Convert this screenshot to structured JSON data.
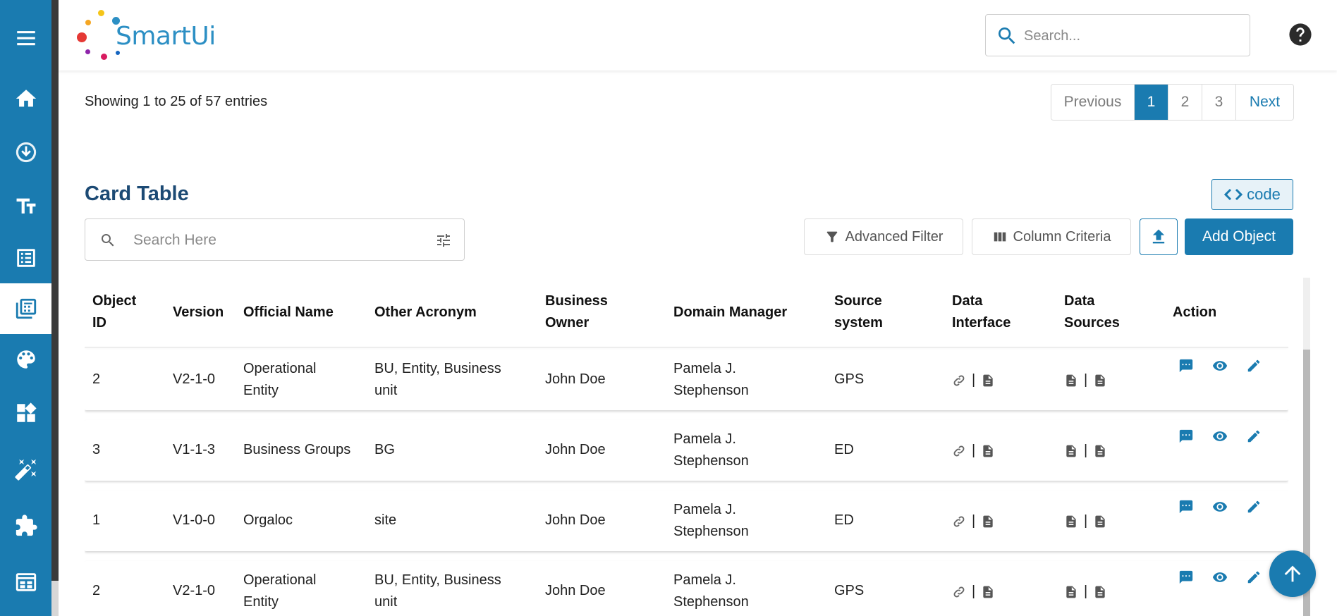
{
  "app": {
    "logo_text": "SmartUi"
  },
  "sidebar": {
    "items": [
      {
        "icon": "menu-icon"
      },
      {
        "icon": "home-icon"
      },
      {
        "icon": "download-circle-icon"
      },
      {
        "icon": "text-fields-icon"
      },
      {
        "icon": "list-alt-icon"
      },
      {
        "icon": "table-icon",
        "active": true
      },
      {
        "icon": "palette-icon"
      },
      {
        "icon": "widgets-icon"
      },
      {
        "icon": "magic-wand-icon"
      },
      {
        "icon": "extension-icon"
      },
      {
        "icon": "calendar-view-icon"
      }
    ]
  },
  "header": {
    "search_placeholder": "Search..."
  },
  "listing": {
    "showing_text": "Showing 1 to 25 of 57 entries",
    "pagination": {
      "previous": "Previous",
      "pages": [
        "1",
        "2",
        "3"
      ],
      "active_page": "1",
      "next": "Next"
    }
  },
  "card": {
    "title": "Card Table",
    "code_label": "code",
    "search_placeholder": "Search Here",
    "advanced_filter": "Advanced Filter",
    "column_criteria": "Column Criteria",
    "add_object": "Add Object"
  },
  "table": {
    "headers": [
      [
        "Object",
        "ID"
      ],
      [
        "Version"
      ],
      [
        "Official Name"
      ],
      [
        "Other Acronym"
      ],
      [
        "Business",
        "Owner"
      ],
      [
        "Domain Manager"
      ],
      [
        "Source",
        "system"
      ],
      [
        "Data",
        "Interface"
      ],
      [
        "Data",
        "Sources"
      ],
      [
        "Action"
      ]
    ],
    "rows": [
      {
        "object_id": "2",
        "version": "V2-1-0",
        "official_name": [
          "Operational",
          "Entity"
        ],
        "other_acronym": [
          "BU, Entity, Business",
          "unit"
        ],
        "business_owner": "John Doe",
        "domain_manager": [
          "Pamela J.",
          "Stephenson"
        ],
        "source_system": "GPS"
      },
      {
        "object_id": "3",
        "version": "V1-1-3",
        "official_name": [
          "Business Groups"
        ],
        "other_acronym": [
          "BG"
        ],
        "business_owner": "John Doe",
        "domain_manager": [
          "Pamela J.",
          "Stephenson"
        ],
        "source_system": "ED"
      },
      {
        "object_id": "1",
        "version": "V1-0-0",
        "official_name": [
          "Orgaloc"
        ],
        "other_acronym": [
          "site"
        ],
        "business_owner": "John Doe",
        "domain_manager": [
          "Pamela J.",
          "Stephenson"
        ],
        "source_system": "ED"
      },
      {
        "object_id": "2",
        "version": "V2-1-0",
        "official_name": [
          "Operational",
          "Entity"
        ],
        "other_acronym": [
          "BU, Entity, Business",
          "unit"
        ],
        "business_owner": "John Doe",
        "domain_manager": [
          "Pamela J.",
          "Stephenson"
        ],
        "source_system": "GPS"
      }
    ],
    "separator": "|"
  },
  "colors": {
    "primary": "#1a7bb0",
    "title": "#1c4a74",
    "sidebar_strip": "#3a3a3a"
  }
}
